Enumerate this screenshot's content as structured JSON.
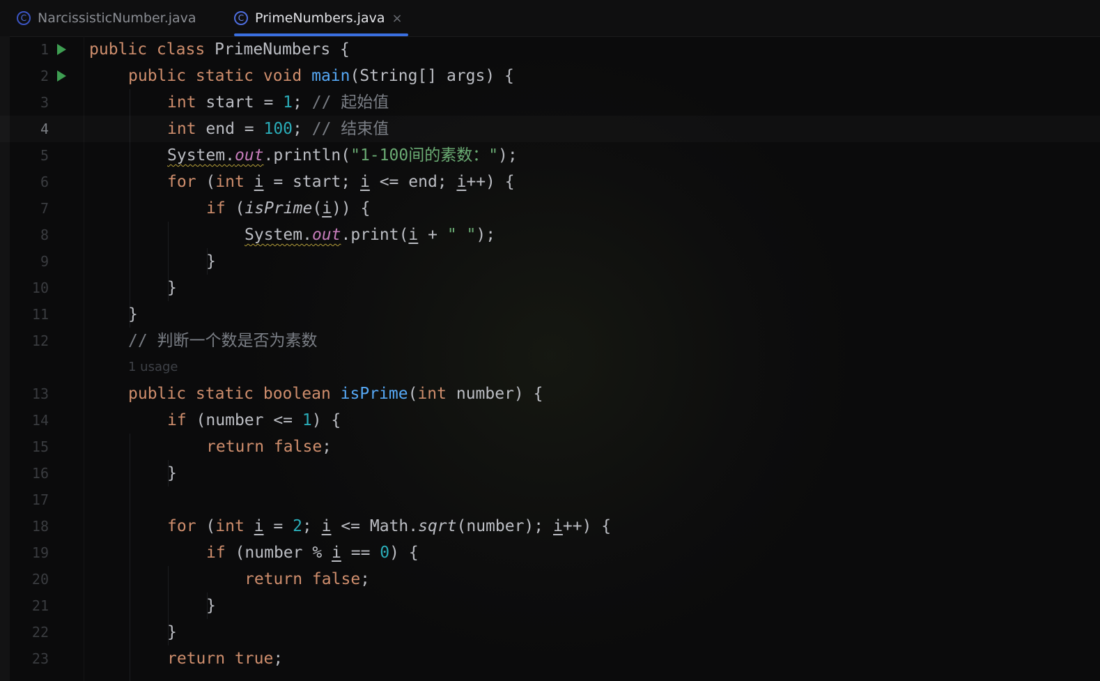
{
  "tabs": [
    {
      "icon": "class-icon",
      "label": "NarcissisticNumber.java",
      "active": false
    },
    {
      "icon": "class-icon",
      "label": "PrimeNumbers.java",
      "active": true
    }
  ],
  "close_glyph": "×",
  "colors": {
    "keyword": "#cf8e6d",
    "number": "#2aacb8",
    "string": "#6aab73",
    "comment": "#7a7e85",
    "method": "#56a8f5",
    "field": "#c77dbb",
    "text": "#bcbec4",
    "run": "#3e9e52",
    "tab_underline": "#3a6fe0"
  },
  "gutter": {
    "line_numbers": [
      "1",
      "2",
      "3",
      "4",
      "5",
      "6",
      "7",
      "8",
      "9",
      "10",
      "11",
      "12",
      "13",
      "14",
      "15",
      "16",
      "17",
      "18",
      "19",
      "20",
      "21",
      "22",
      "23"
    ],
    "current_line": "4"
  },
  "inlay_hint": "1 usage",
  "code": {
    "l1": {
      "a": "public class",
      "b": " PrimeNumbers {"
    },
    "l2": {
      "a": "public static void",
      "b": "main",
      "c": "(String[] args) {"
    },
    "l3": {
      "a": "int",
      "b": " start = ",
      "c": "1",
      "d": "; ",
      "e": "// 起始值"
    },
    "l4": {
      "a": "int",
      "b": " end = ",
      "c": "100",
      "d": "; ",
      "e": "// 结束值"
    },
    "l5": {
      "a": "System.",
      "b": "out",
      "c": ".println(",
      "d": "\"1-100间的素数：\"",
      "e": ");"
    },
    "l6": {
      "a": "for",
      "b": " (",
      "c": "int",
      "d": " ",
      "e": "i",
      "f": " = start; ",
      "g": "i",
      "h": " <= end; ",
      "i": "i",
      "j": "++) {"
    },
    "l7": {
      "a": "if",
      "b": " (",
      "c": "isPrime",
      "d": "(",
      "e": "i",
      "f": ")) {"
    },
    "l8": {
      "a": "System.",
      "b": "out",
      "c": ".print(",
      "d": "i",
      "e": " + ",
      "f": "\" \"",
      "g": ");"
    },
    "l9": {
      "a": "}"
    },
    "l10": {
      "a": "}"
    },
    "l11": {
      "a": "}"
    },
    "l12": {
      "a": "// 判断一个数是否为素数"
    },
    "l13": {
      "a": "public static boolean",
      "b": " ",
      "c": "isPrime",
      "d": "(",
      "e": "int",
      "f": " number) {"
    },
    "l14": {
      "a": "if",
      "b": " (number <= ",
      "c": "1",
      "d": ") {"
    },
    "l15": {
      "a": "return false",
      "b": ";"
    },
    "l16": {
      "a": "}"
    },
    "l18": {
      "a": "for",
      "b": " (",
      "c": "int",
      "d": " ",
      "e": "i",
      "f": " = ",
      "g": "2",
      "h": "; ",
      "i": "i",
      "j": " <= Math.",
      "k": "sqrt",
      "l": "(number); ",
      "m": "i",
      "n": "++) {"
    },
    "l19": {
      "a": "if",
      "b": " (number % ",
      "c": "i",
      "d": " == ",
      "e": "0",
      "f": ") {"
    },
    "l20": {
      "a": "return false",
      "b": ";"
    },
    "l21": {
      "a": "}"
    },
    "l22": {
      "a": "}"
    },
    "l23": {
      "a": "return true",
      "b": ";"
    }
  }
}
